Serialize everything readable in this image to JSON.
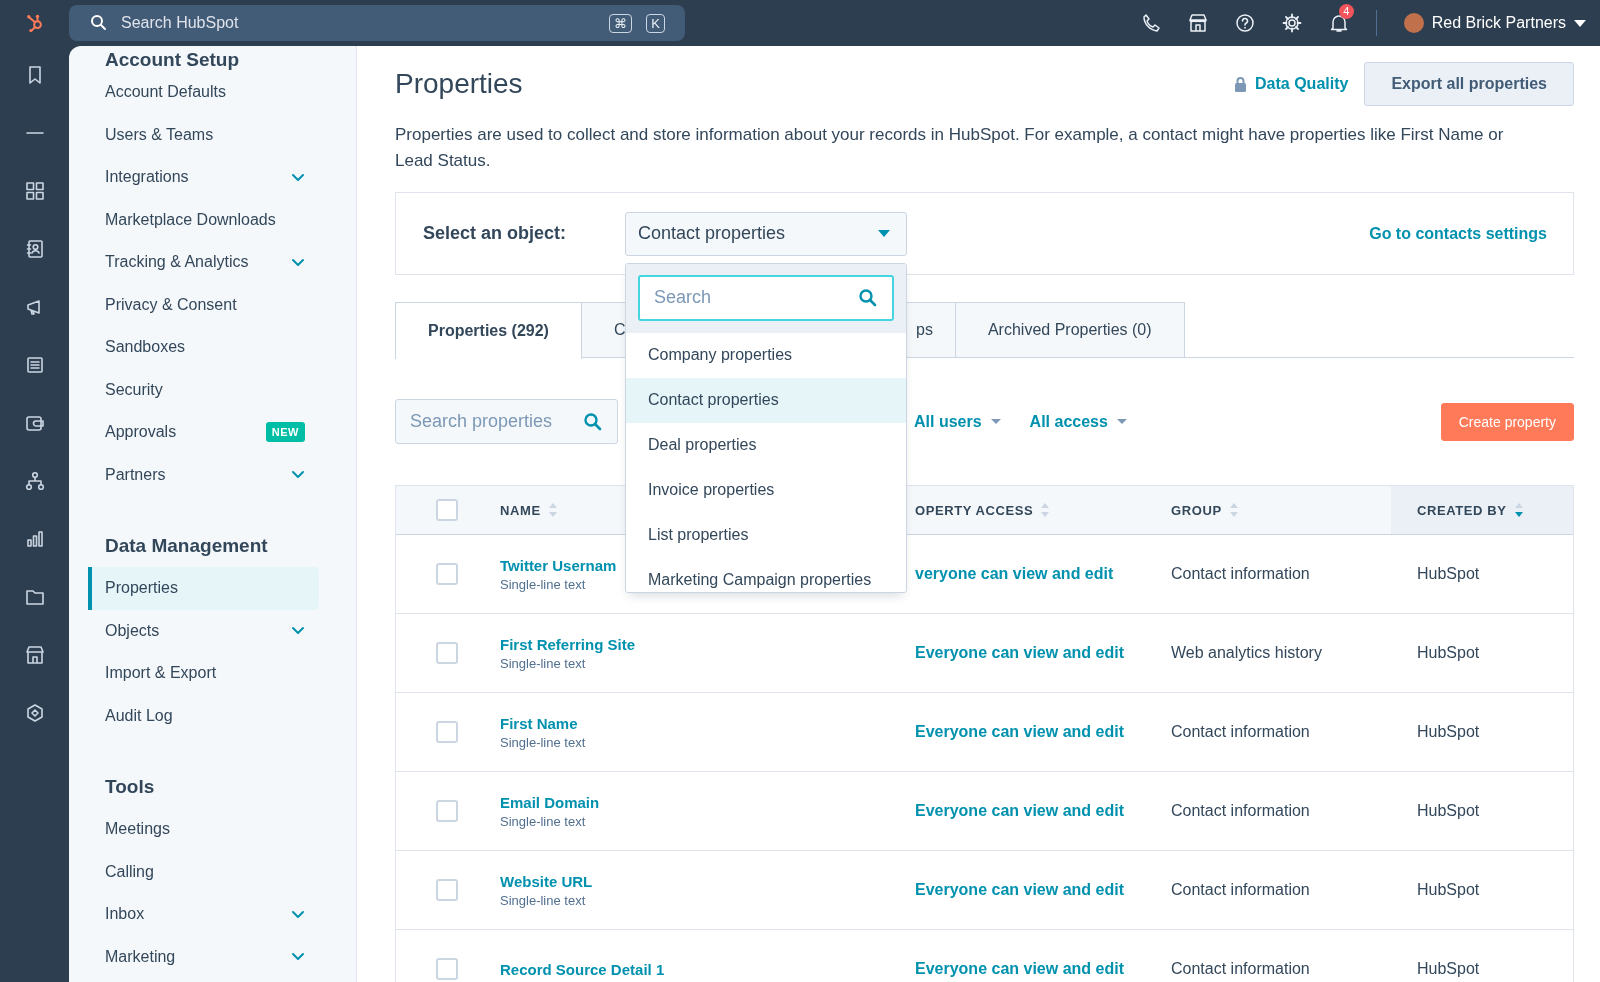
{
  "top_bar": {
    "search": {
      "placeholder": "Search HubSpot",
      "shortcut_keys": [
        "⌘",
        "K"
      ]
    },
    "notifications": {
      "count": "4"
    },
    "account": {
      "name": "Red Brick Partners"
    }
  },
  "sidebar": {
    "sections": [
      {
        "heading": "Account Setup",
        "items": [
          {
            "label": "Account Defaults",
            "kind": "link",
            "selected": false
          },
          {
            "label": "Users & Teams",
            "kind": "link",
            "selected": false
          },
          {
            "label": "Integrations",
            "kind": "expandable",
            "expanded": false,
            "selected": false
          },
          {
            "label": "Marketplace Downloads",
            "kind": "link",
            "selected": false
          },
          {
            "label": "Tracking & Analytics",
            "kind": "expandable",
            "expanded": false,
            "selected": false
          },
          {
            "label": "Privacy & Consent",
            "kind": "link",
            "selected": false
          },
          {
            "label": "Sandboxes",
            "kind": "link",
            "selected": false
          },
          {
            "label": "Security",
            "kind": "link",
            "selected": false
          },
          {
            "label": "Approvals",
            "kind": "link",
            "badge": "NEW",
            "selected": false
          },
          {
            "label": "Partners",
            "kind": "expandable",
            "expanded": false,
            "selected": false
          }
        ]
      },
      {
        "heading": "Data Management",
        "items": [
          {
            "label": "Properties",
            "kind": "link",
            "selected": true
          },
          {
            "label": "Objects",
            "kind": "expandable",
            "expanded": false,
            "selected": false
          },
          {
            "label": "Import & Export",
            "kind": "link",
            "selected": false
          },
          {
            "label": "Audit Log",
            "kind": "link",
            "selected": false
          }
        ]
      },
      {
        "heading": "Tools",
        "items": [
          {
            "label": "Meetings",
            "kind": "link",
            "selected": false
          },
          {
            "label": "Calling",
            "kind": "link",
            "selected": false
          },
          {
            "label": "Inbox",
            "kind": "expandable",
            "expanded": false,
            "selected": false
          },
          {
            "label": "Marketing",
            "kind": "expandable",
            "expanded": false,
            "selected": false
          }
        ]
      }
    ]
  },
  "page": {
    "title": "Properties",
    "data_quality_link": "Data Quality",
    "export_button": "Export all properties",
    "description": "Properties are used to collect and store information about your records in HubSpot. For example, a contact might have properties like First Name or Lead Status."
  },
  "object_selector": {
    "label": "Select an object:",
    "value": "Contact properties",
    "open": true,
    "settings_link": "Go to contacts settings"
  },
  "object_dropdown": {
    "search_placeholder": "Search",
    "options": [
      {
        "label": "Company properties",
        "selected": false
      },
      {
        "label": "Contact properties",
        "selected": true
      },
      {
        "label": "Deal properties",
        "selected": false
      },
      {
        "label": "Invoice properties",
        "selected": false
      },
      {
        "label": "List properties",
        "selected": false
      },
      {
        "label": "Marketing Campaign properties",
        "selected": false
      }
    ]
  },
  "tabs": [
    {
      "label": "Properties (292)",
      "selected": true
    },
    {
      "label": "C",
      "selected": false
    },
    {
      "label": "ps",
      "selected": false
    },
    {
      "label": "Archived Properties (0)",
      "selected": false
    }
  ],
  "filters": {
    "search_placeholder": "Search properties",
    "users_filter": "All users",
    "access_filter": "All access",
    "create_button": "Create property"
  },
  "table": {
    "select_all_checked": false,
    "columns": [
      {
        "label": "NAME",
        "sorted": false
      },
      {
        "label": "OPERTY ACCESS",
        "sorted": false
      },
      {
        "label": "GROUP",
        "sorted": false
      },
      {
        "label": "CREATED BY",
        "sorted": true
      }
    ],
    "rows": [
      {
        "checked": false,
        "name": "Twitter Usernam",
        "type": "Single-line text",
        "access": "veryone can view and edit",
        "group": "Contact information",
        "created_by": "HubSpot"
      },
      {
        "checked": false,
        "name": "First Referring Site",
        "type": "Single-line text",
        "access": "Everyone can view and edit",
        "group": "Web analytics history",
        "created_by": "HubSpot"
      },
      {
        "checked": false,
        "name": "First Name",
        "type": "Single-line text",
        "access": "Everyone can view and edit",
        "group": "Contact information",
        "created_by": "HubSpot"
      },
      {
        "checked": false,
        "name": "Email Domain",
        "type": "Single-line text",
        "access": "Everyone can view and edit",
        "group": "Contact information",
        "created_by": "HubSpot"
      },
      {
        "checked": false,
        "name": "Website URL",
        "type": "Single-line text",
        "access": "Everyone can view and edit",
        "group": "Contact information",
        "created_by": "HubSpot"
      },
      {
        "checked": false,
        "name": "Record Source Detail 1",
        "access": "Everyone can view and edit",
        "group": "Contact information",
        "created_by": "HubSpot"
      }
    ]
  }
}
